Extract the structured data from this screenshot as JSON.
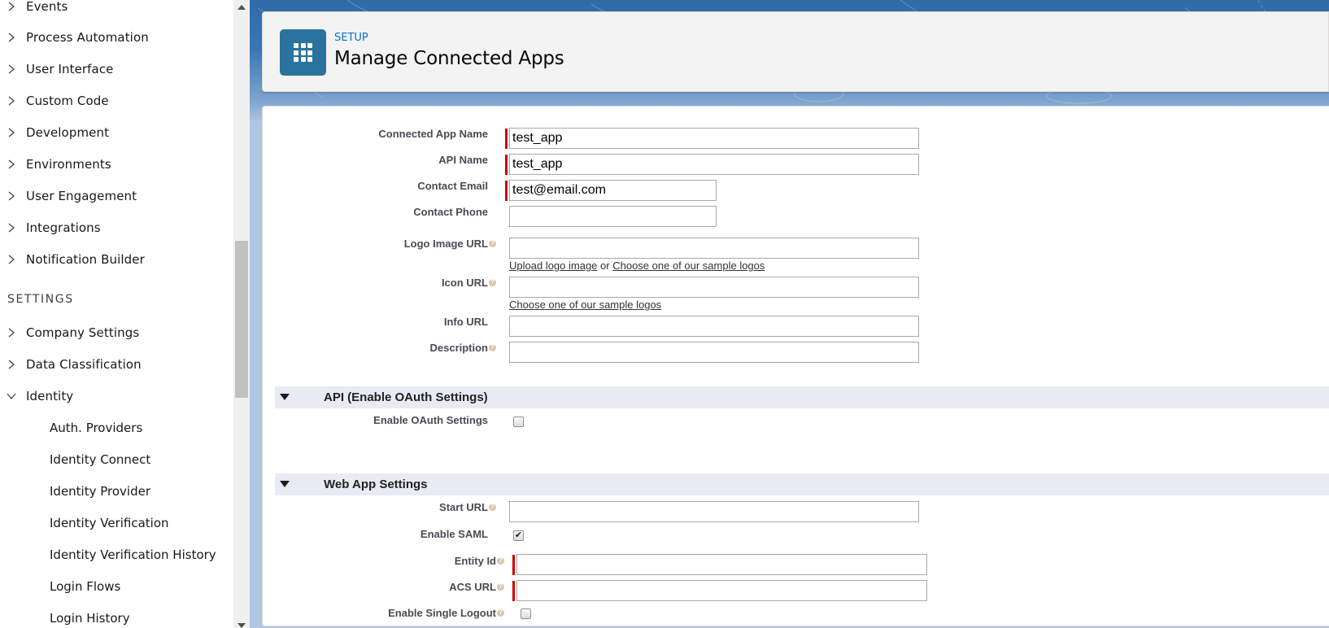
{
  "sidebar": {
    "items_top": [
      {
        "label": "Events",
        "expanded": false
      },
      {
        "label": "Process Automation",
        "expanded": false
      },
      {
        "label": "User Interface",
        "expanded": false
      },
      {
        "label": "Custom Code",
        "expanded": false
      },
      {
        "label": "Development",
        "expanded": false
      },
      {
        "label": "Environments",
        "expanded": false
      },
      {
        "label": "User Engagement",
        "expanded": false
      },
      {
        "label": "Integrations",
        "expanded": false
      },
      {
        "label": "Notification Builder",
        "expanded": false
      }
    ],
    "settings_heading": "SETTINGS",
    "items_settings": [
      {
        "label": "Company Settings",
        "expanded": false
      },
      {
        "label": "Data Classification",
        "expanded": false
      },
      {
        "label": "Identity",
        "expanded": true
      }
    ],
    "identity_children": [
      "Auth. Providers",
      "Identity Connect",
      "Identity Provider",
      "Identity Verification",
      "Identity Verification History",
      "Login Flows",
      "Login History"
    ]
  },
  "header": {
    "breadcrumb": "SETUP",
    "title": "Manage Connected Apps",
    "icon": "app-grid-icon",
    "icon_color": "#2a739e"
  },
  "form": {
    "basic": {
      "connected_app_name": {
        "label": "Connected App Name",
        "value": "test_app",
        "required": true
      },
      "api_name": {
        "label": "API Name",
        "value": "test_app",
        "required": true
      },
      "contact_email": {
        "label": "Contact Email",
        "value": "test@email.com",
        "required": true
      },
      "contact_phone": {
        "label": "Contact Phone",
        "value": ""
      },
      "logo_image_url": {
        "label": "Logo Image URL",
        "value": "",
        "help": true
      },
      "logo_links": {
        "upload": "Upload logo image",
        "or": "or",
        "choose": "Choose one of our sample logos"
      },
      "icon_url": {
        "label": "Icon URL",
        "value": "",
        "help": true
      },
      "icon_links": {
        "choose": "Choose one of our sample logos"
      },
      "info_url": {
        "label": "Info URL",
        "value": ""
      },
      "description": {
        "label": "Description",
        "value": "",
        "help": true
      }
    },
    "api_section": {
      "title": "API (Enable OAuth Settings)",
      "enable_oauth": {
        "label": "Enable OAuth Settings",
        "checked": false
      }
    },
    "web_app_section": {
      "title": "Web App Settings",
      "start_url": {
        "label": "Start URL",
        "value": "",
        "help": true
      },
      "enable_saml": {
        "label": "Enable SAML",
        "checked": true,
        "check_glyph": "✔"
      },
      "entity_id": {
        "label": "Entity Id",
        "value": "",
        "required": true,
        "help": true
      },
      "acs_url": {
        "label": "ACS URL",
        "value": "",
        "required": true,
        "help": true
      },
      "enable_single_logout": {
        "label": "Enable Single Logout",
        "checked": false,
        "help": true
      }
    }
  },
  "colors": {
    "required_bar": "#cc0000",
    "link_blue": "#0070d2",
    "section_band": "#e8ebf3"
  }
}
